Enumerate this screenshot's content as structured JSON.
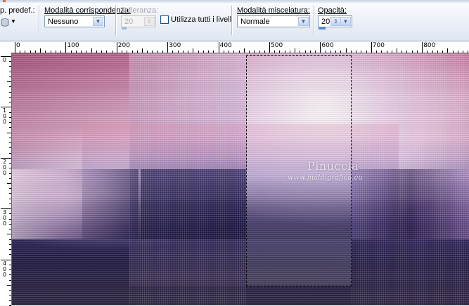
{
  "toolbar": {
    "preset_label": "p. predef.:",
    "match_mode": {
      "label": "Modalità corrispondenza:",
      "value": "Nessuno"
    },
    "tolerance": {
      "label": "Tolleranza:",
      "value": "20"
    },
    "all_layers": {
      "label": "Utilizza tutti i livelli",
      "checked": false
    },
    "blend_mode": {
      "label": "Modalità miscelatura:",
      "value": "Normale"
    },
    "opacity": {
      "label": "Opacità:",
      "value": "20"
    }
  },
  "ruler": {
    "horizontal": [
      "0",
      "100",
      "200",
      "300",
      "400",
      "500",
      "600",
      "700",
      "800"
    ],
    "vertical": [
      "0",
      "100",
      "200",
      "300",
      "400"
    ]
  },
  "canvas": {
    "watermark_title": "Pinuccia",
    "watermark_url": "www.maldigrafica.eu"
  },
  "colors": {
    "accent": "#4a86d8",
    "toolbar_bg": "#dfe6f1",
    "selection": "#ffffff"
  }
}
